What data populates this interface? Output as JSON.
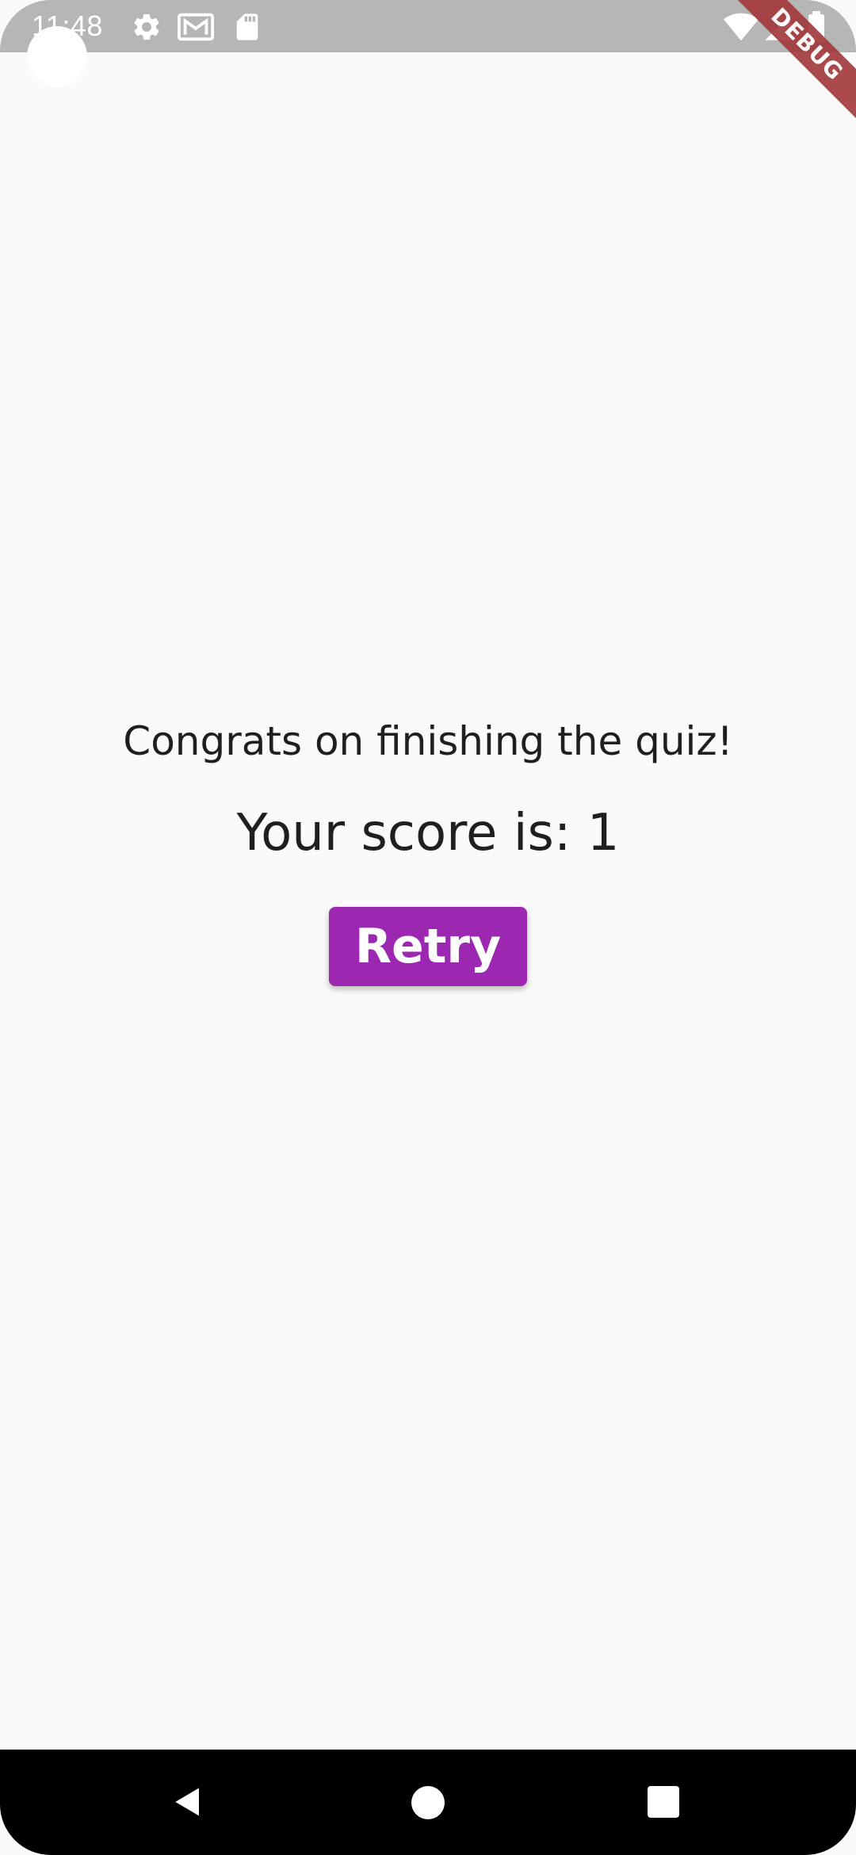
{
  "status_bar": {
    "time": "11:48",
    "left_icons": [
      "settings-icon",
      "gmail-icon",
      "sd-card-icon"
    ],
    "right_icons": [
      "wifi-icon",
      "signal-icon",
      "battery-icon"
    ]
  },
  "debug_banner": {
    "label": "DEBUG",
    "color": "#a3373a"
  },
  "quiz_result": {
    "message": "Congrats on finishing the quiz!",
    "score_text": "Your score is: 1",
    "retry_label": "Retry"
  },
  "colors": {
    "accent": "#9c27b0",
    "background": "#fafafa",
    "status_bar": "#b6b6b6"
  },
  "nav_bar": {
    "buttons": [
      "back-icon",
      "home-icon",
      "recents-icon"
    ]
  }
}
